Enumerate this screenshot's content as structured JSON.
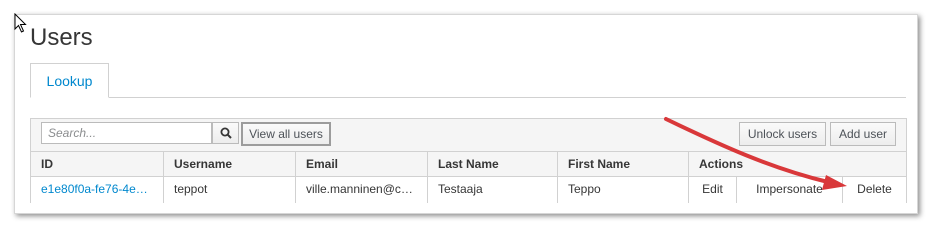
{
  "page": {
    "title": "Users"
  },
  "tabs": [
    {
      "label": "Lookup"
    }
  ],
  "toolbar": {
    "search_placeholder": "Search...",
    "view_all_label": "View all users",
    "unlock_label": "Unlock users",
    "add_user_label": "Add user"
  },
  "table": {
    "columns": [
      "ID",
      "Username",
      "Email",
      "Last Name",
      "First Name",
      "Actions"
    ],
    "rows": [
      {
        "id": "e1e80f0a-fe76-4e…",
        "username": "teppot",
        "email": "ville.manninen@c…",
        "last_name": "Testaaja",
        "first_name": "Teppo",
        "actions": [
          "Edit",
          "Impersonate",
          "Delete"
        ]
      }
    ]
  },
  "icons": {
    "cursor": "mouse-pointer-icon",
    "search": "search-icon",
    "annotation": "red-arrow-icon"
  },
  "colors": {
    "link": "#0088ce",
    "annotation_arrow": "#d9383a"
  }
}
